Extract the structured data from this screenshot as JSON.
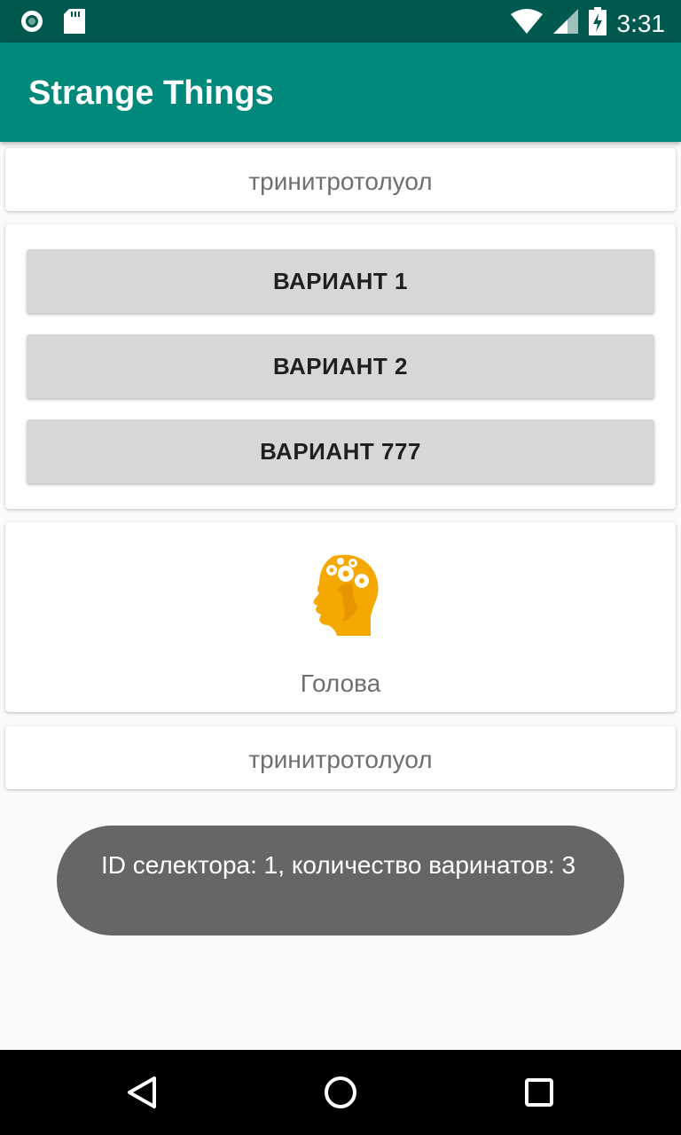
{
  "status_bar": {
    "time": "3:31",
    "icons": [
      "circle-notification-icon",
      "sd-card-icon",
      "wifi-icon",
      "signal-icon",
      "battery-charging-icon"
    ]
  },
  "app_bar": {
    "title": "Strange Things"
  },
  "card_top": {
    "text": "тринитротолуол"
  },
  "variants": {
    "button_1": "ВАРИАНТ 1",
    "button_2": "ВАРИАНТ 2",
    "button_3": "ВАРИАНТ 777"
  },
  "head_card": {
    "caption": "Голова",
    "icon": "head-gears-icon"
  },
  "card_bottom": {
    "text": "тринитротолуол"
  },
  "toast": {
    "message": "ID селектора: 1, количество варинатов: 3"
  },
  "nav_bar": {
    "icons": [
      "back-icon",
      "home-icon",
      "recents-icon"
    ]
  },
  "colors": {
    "status_bar": "#00594f",
    "app_bar": "#00897b",
    "button_bg": "#d6d7d7",
    "toast_bg": "#666666",
    "head_icon": "#f5a800"
  }
}
